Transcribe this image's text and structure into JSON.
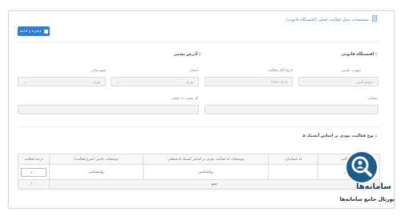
{
  "header": {
    "title": "مشخصات محل فعالیت اصلی (اقتستگاه قانونی)",
    "save_button": "ذخیره و ادامه"
  },
  "legal_section": {
    "heading": "اقتستگاه قانونی :",
    "fields": [
      {
        "label": "شهرت کسبی",
        "value": "خواجو آشتی"
      },
      {
        "label": "تاریخ آغاز فعالیت",
        "value": "۱۳۹۶/۰۸/۰۸"
      },
      {
        "label": "استان",
        "value": "تهران"
      },
      {
        "label": "شهرستان",
        "value": "تهران"
      },
      {
        "label": "نشانی",
        "value": ""
      },
      {
        "label": "کد پستی ده رقمی",
        "value": ""
      }
    ]
  },
  "postal_section": {
    "heading": "آدرس پستی :"
  },
  "activity_section": {
    "heading": "نوع فعالیت مودی بر اساس آیسیک ۵ :",
    "columns": [
      "نوع فعالیت",
      "کد استاندارد",
      "توضیحات کد فعالیت مودی بر اساس آیسیک ۵ سطحی",
      "توضیحات جانبی (شرح فعالیت)",
      "درصد فعالیت"
    ],
    "rows": [
      {
        "activity": "ب قابی",
        "code": "",
        "isic_desc": "روانشناسی",
        "side_desc": "روانشناسی",
        "percent": "۱۰۰"
      }
    ],
    "total_label": "جمع",
    "total_percent": "۱۰۰"
  },
  "watermark": {
    "name": "سامانه‌ها",
    "tagline": "پورتال جامع سامانه‌ها"
  },
  "colors": {
    "accent": "#2e7fd3",
    "title_blue": "#5b7ac4",
    "logo_dark": "#173c5c"
  }
}
